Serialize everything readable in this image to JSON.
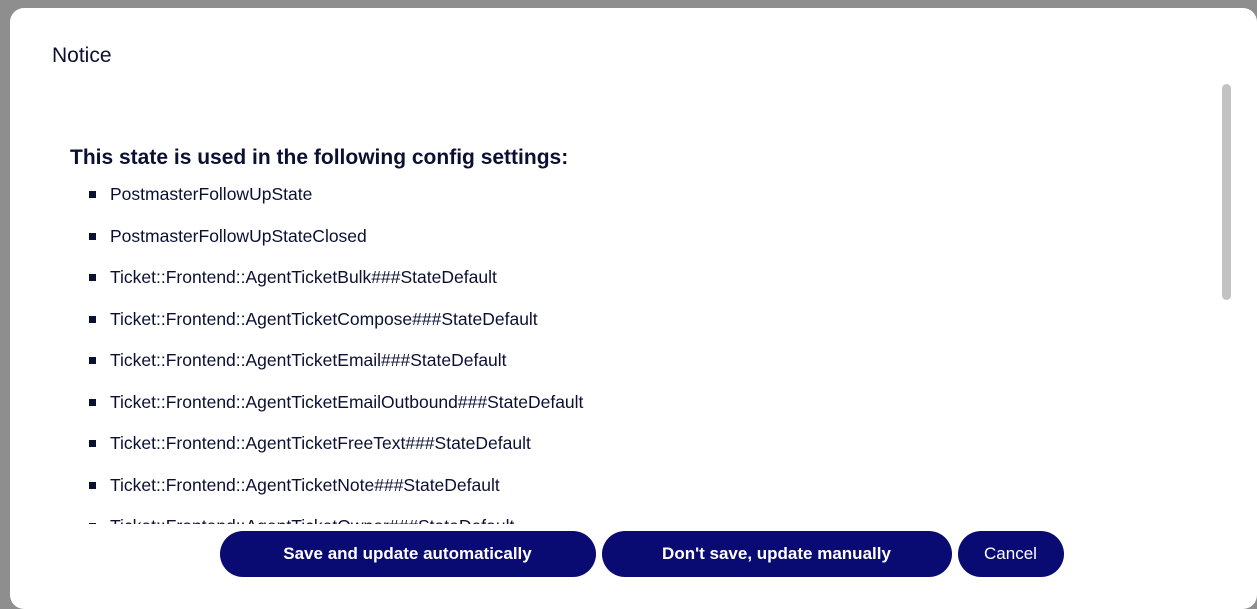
{
  "dialog": {
    "title": "Notice",
    "heading": "This state is used in the following config settings:",
    "settings": [
      "PostmasterFollowUpState",
      "PostmasterFollowUpStateClosed",
      "Ticket::Frontend::AgentTicketBulk###StateDefault",
      "Ticket::Frontend::AgentTicketCompose###StateDefault",
      "Ticket::Frontend::AgentTicketEmail###StateDefault",
      "Ticket::Frontend::AgentTicketEmailOutbound###StateDefault",
      "Ticket::Frontend::AgentTicketFreeText###StateDefault",
      "Ticket::Frontend::AgentTicketNote###StateDefault",
      "Ticket::Frontend::AgentTicketOwner###StateDefault"
    ],
    "buttons": {
      "save_auto": "Save and update automatically",
      "save_manual": "Don't save, update manually",
      "cancel": "Cancel"
    }
  },
  "colors": {
    "text": "#0b1033",
    "button_bg": "#0a0a73",
    "button_text": "#ffffff",
    "scrollbar": "#c2c2c2"
  }
}
